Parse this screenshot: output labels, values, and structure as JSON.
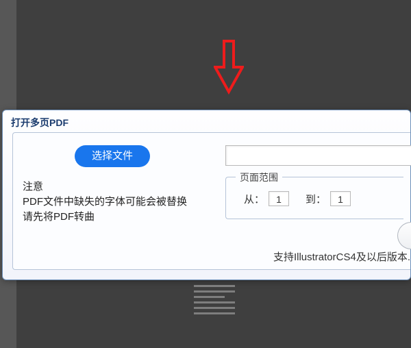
{
  "dialog": {
    "title": "打开多页PDF",
    "select_file_label": "选择文件",
    "file_path_value": "",
    "note_heading": "注意",
    "note_line_1": "PDF文件中缺失的字体可能会被替换",
    "note_line_2": "请先将PDF转曲",
    "page_range_legend": "页面范围",
    "from_label": "从：",
    "to_label": "到：",
    "from_value": "1",
    "to_value": "1",
    "footer": "支持IllustratorCS4及以后版本."
  }
}
